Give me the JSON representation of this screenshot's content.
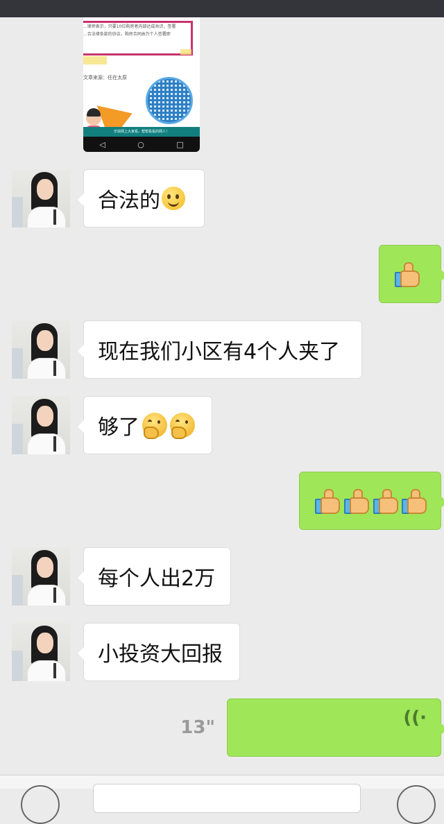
{
  "colors": {
    "status_bar": "#34353a",
    "chat_bg": "#ebebeb",
    "incoming_bubble": "#ffffff",
    "outgoing_bubble": "#9fe658",
    "duration_text": "#9a9a9a"
  },
  "shared_image": {
    "line1": "...律师表示，只要10位购房者内部达成共识，签署",
    "line2": "...合法律条款的协议，购房合同由万个人签署即",
    "source": "文章来源：任在太原",
    "banner": "乐快网上大家看，帮帮看看的网人！",
    "nav_back": "◁",
    "nav_home": "○",
    "nav_recent": "□"
  },
  "messages": [
    {
      "id": "m1",
      "direction": "in",
      "text": "合法的",
      "emoji": [
        "smile"
      ]
    },
    {
      "id": "m2",
      "direction": "out",
      "emoji": [
        "thumbs-up"
      ]
    },
    {
      "id": "m3",
      "direction": "in",
      "text": "现在我们小区有4个人夹了",
      "emoji": []
    },
    {
      "id": "m4",
      "direction": "in",
      "text": "够了",
      "emoji": [
        "thinking",
        "thinking"
      ]
    },
    {
      "id": "m5",
      "direction": "out",
      "emoji": [
        "thumbs-up",
        "thumbs-up",
        "thumbs-up",
        "thumbs-up"
      ]
    },
    {
      "id": "m6",
      "direction": "in",
      "text": "每个人出2万",
      "emoji": []
    },
    {
      "id": "m7",
      "direction": "in",
      "text": "小投资大回报",
      "emoji": []
    }
  ],
  "voice_message": {
    "duration": "13\"",
    "icon": "voice-wave-icon"
  }
}
